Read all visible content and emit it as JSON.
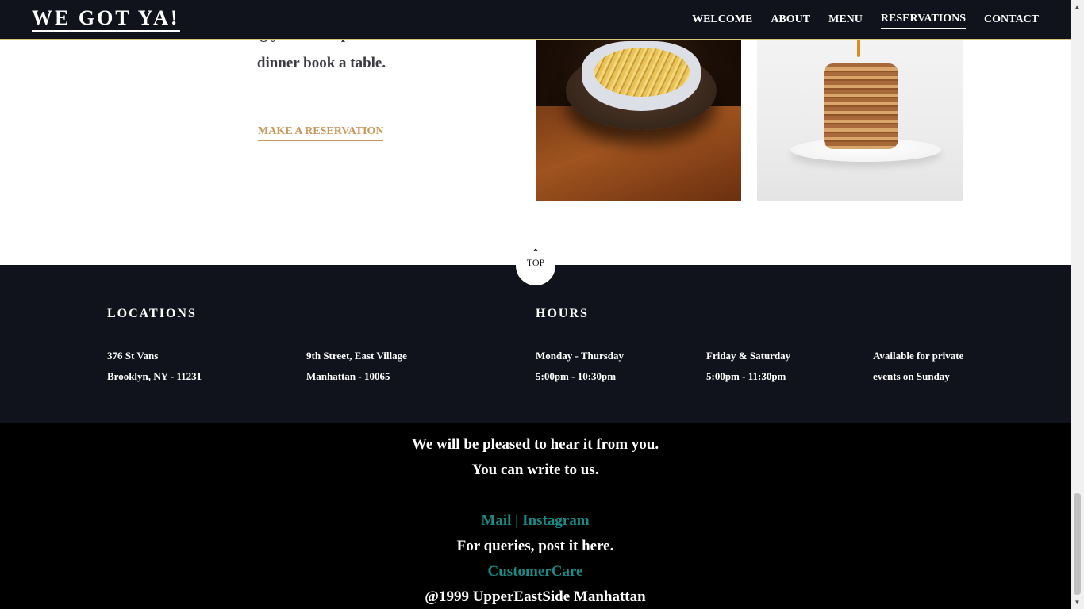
{
  "header": {
    "logo": "WE GOT YA!",
    "nav": [
      {
        "label": "WELCOME"
      },
      {
        "label": "ABOUT"
      },
      {
        "label": "MENU"
      },
      {
        "label": "RESERVATIONS",
        "active": true
      },
      {
        "label": "CONTACT"
      }
    ]
  },
  "intro": {
    "lines": [
      "forward in seeing you at our place. For a hassel free",
      "dinner book a table."
    ],
    "reserve_link": "MAKE A RESERVATION"
  },
  "photos": [
    {
      "name": "fries-photo"
    },
    {
      "name": "pancakes-photo"
    }
  ],
  "top_button": {
    "icon": "chevron-up-icon",
    "label": "TOP"
  },
  "info": {
    "locations_heading": "LOCATIONS",
    "hours_heading": "HOURS",
    "locations": [
      {
        "line1": "376 St Vans",
        "line2": "Brooklyn, NY - 11231"
      },
      {
        "line1": "9th Street, East Village",
        "line2": "Manhattan - 10065"
      }
    ],
    "hours": [
      {
        "line1": "Monday - Thursday",
        "line2": "5:00pm - 10:30pm"
      },
      {
        "line1": "Friday & Saturday",
        "line2": "5:00pm - 11:30pm"
      },
      {
        "line1": "Available for private",
        "line2": "events on Sunday"
      }
    ]
  },
  "footer": {
    "line1": "We will be pleased to hear it from you.",
    "line2": "You can write to us.",
    "mail_link": "Mail",
    "separator": " | ",
    "instagram_link": "Instagram",
    "queries": "For queries, post it here.",
    "customer_care": "CustomerCare",
    "copyright": "@1999 UpperEastSide Manhattan"
  },
  "colors": {
    "header_bg": "#11131c",
    "accent_gold": "#c7965a",
    "footer_link": "#1a8a86",
    "footer_bg": "#000000"
  }
}
